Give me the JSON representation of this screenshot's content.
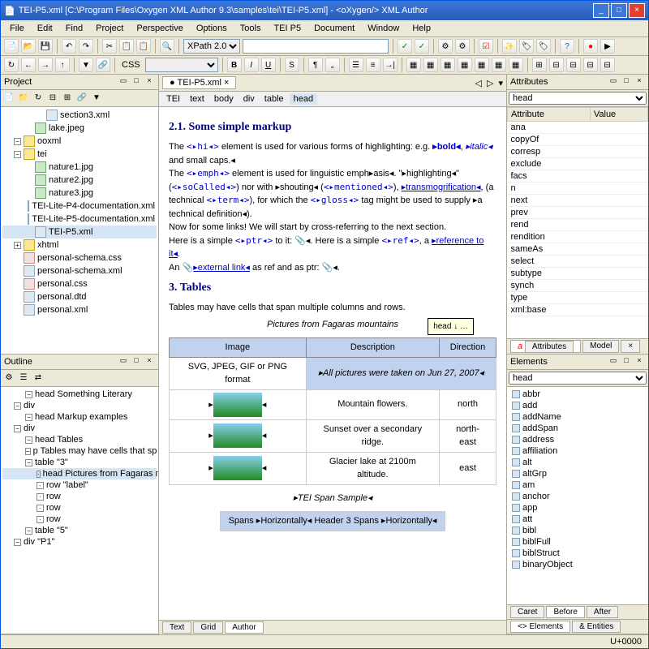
{
  "window": {
    "title": "TEI-P5.xml [C:\\Program Files\\Oxygen XML Author 9.3\\samples\\tei\\TEI-P5.xml] - <oXygen/> XML Author"
  },
  "menu": [
    "File",
    "Edit",
    "Find",
    "Project",
    "Perspective",
    "Options",
    "Tools",
    "TEI P5",
    "Document",
    "Window",
    "Help"
  ],
  "toolbar1": {
    "xpath_label": "XPath 2.0"
  },
  "toolbar2": {
    "css_label": "CSS",
    "b": "B",
    "i": "I",
    "u": "U",
    "s": "S"
  },
  "project": {
    "title": "Project",
    "tree": [
      {
        "d": 3,
        "t": "xml",
        "name": "section3.xml"
      },
      {
        "d": 2,
        "t": "img",
        "name": "lake.jpeg"
      },
      {
        "d": 1,
        "t": "folder",
        "name": "ooxml",
        "exp": "−"
      },
      {
        "d": 1,
        "t": "folder",
        "name": "tei",
        "exp": "−"
      },
      {
        "d": 2,
        "t": "img",
        "name": "nature1.jpg"
      },
      {
        "d": 2,
        "t": "img",
        "name": "nature2.jpg"
      },
      {
        "d": 2,
        "t": "img",
        "name": "nature3.jpg"
      },
      {
        "d": 2,
        "t": "xml",
        "name": "TEI-Lite-P4-documentation.xml"
      },
      {
        "d": 2,
        "t": "xml",
        "name": "TEI-Lite-P5-documentation.xml"
      },
      {
        "d": 2,
        "t": "xml",
        "name": "TEI-P5.xml",
        "sel": true
      },
      {
        "d": 1,
        "t": "folder",
        "name": "xhtml",
        "exp": "+"
      },
      {
        "d": 1,
        "t": "css",
        "name": "personal-schema.css"
      },
      {
        "d": 1,
        "t": "xml",
        "name": "personal-schema.xml"
      },
      {
        "d": 1,
        "t": "css",
        "name": "personal.css"
      },
      {
        "d": 1,
        "t": "xml",
        "name": "personal.dtd"
      },
      {
        "d": 1,
        "t": "xml",
        "name": "personal.xml"
      }
    ]
  },
  "outline": {
    "title": "Outline",
    "items": [
      {
        "d": 1,
        "name": "head Something Literary"
      },
      {
        "d": 0,
        "name": "div"
      },
      {
        "d": 1,
        "name": "head Markup examples"
      },
      {
        "d": 0,
        "name": "div"
      },
      {
        "d": 1,
        "name": "head Tables"
      },
      {
        "d": 1,
        "name": "p Tables may have cells that sp"
      },
      {
        "d": 1,
        "name": "table \"3\""
      },
      {
        "d": 2,
        "name": "head Pictures from Fagaras mountai",
        "sel": true
      },
      {
        "d": 2,
        "name": "row \"label\""
      },
      {
        "d": 2,
        "name": "row"
      },
      {
        "d": 2,
        "name": "row"
      },
      {
        "d": 2,
        "name": "row"
      },
      {
        "d": 1,
        "name": "table \"5\""
      },
      {
        "d": 0,
        "name": "div \"P1\""
      }
    ]
  },
  "doc": {
    "tab": "TEI-P5.xml",
    "crumbs": [
      "TEI",
      "text",
      "body",
      "div",
      "table",
      "head"
    ],
    "h1": "2.1. Some simple markup",
    "p1a": "The ",
    "p1_tag": "<▸hi◂>",
    "p1b": " element is used for various forms of highlighting: e.g. ",
    "p1_bold": "▸bold◂",
    "p1c": ", ",
    "p1_italic": "▸italic◂",
    "p1d": " and small caps.◂",
    "p2a": "The ",
    "p2_emph": "<▸emph◂>",
    "p2b": " element is used for linguistic emph▸asis◂. \"▸highlighting◂\" (",
    "p2_so": "<▸soCalled◂>",
    "p2c": ") nor with ▸shouting◂ (",
    "p2_men": "<▸mentioned◂>",
    "p2d": "), ",
    "p2_trans": "▸transmogrification◂",
    "p2e": ", (a technical ",
    "p2_term": "<▸term◂>",
    "p2f": "), for which the ",
    "p2_gloss": "<▸gloss◂>",
    "p2g": " tag might be used to supply ▸a technical definition◂).",
    "p3": "Now for some links! We will start by cross-referring to the next section.",
    "p4a": "Here is a simple ",
    "p4_ptr": "<▸ptr◂>",
    "p4b": " to it: 📎◂. Here is a simple ",
    "p4_ref": "<▸ref◂>",
    "p4c": ", a ",
    "p4_reflink": "▸reference to it◂",
    "p4d": ".",
    "p5a": "An 📎",
    "p5_link": "▸external link◂",
    "p5b": " as ref and as ptr: 📎◂.",
    "h2": "3. Tables",
    "p6": "Tables may have cells that span multiple columns and rows.",
    "caption": "Pictures from Fagaras mountains",
    "th1": "Image",
    "th2": "Description",
    "th3": "Direction",
    "tooltip": "head ↓ …",
    "chart_data": {
      "type": "table",
      "title": "Pictures from Fagaras mountains",
      "columns": [
        "Image",
        "Description",
        "Direction"
      ],
      "rows": [
        [
          "SVG, JPEG, GIF or PNG format",
          "▸All pictures were taken on Jun 27, 2007◂",
          ""
        ],
        [
          "",
          "Mountain flowers.",
          "north"
        ],
        [
          "",
          "Sunset over a secondary ridge.",
          "north-east"
        ],
        [
          "",
          "Glacier lake at 2100m altitude.",
          "east"
        ]
      ]
    },
    "span_caption": "▸TEI Span Sample◂",
    "span_row": "Spans ▸Horizontally◂ Header 3 Spans ▸Horizontally◂",
    "bottom_tabs": [
      "Text",
      "Grid",
      "Author"
    ]
  },
  "attributes": {
    "title": "Attributes",
    "element": "head",
    "cols": [
      "Attribute",
      "Value"
    ],
    "rows": [
      "ana",
      "copyOf",
      "corresp",
      "exclude",
      "facs",
      "n",
      "next",
      "prev",
      "rend",
      "rendition",
      "sameAs",
      "select",
      "subtype",
      "synch",
      "type",
      "xml:base"
    ],
    "tab1": "Attributes",
    "tab2": "Model"
  },
  "elements": {
    "title": "Elements",
    "element": "head",
    "list": [
      "abbr",
      "add",
      "addName",
      "addSpan",
      "address",
      "affiliation",
      "alt",
      "altGrp",
      "am",
      "anchor",
      "app",
      "att",
      "bibl",
      "biblFull",
      "biblStruct",
      "binaryObject"
    ],
    "tabs": [
      "Caret",
      "Before",
      "After"
    ],
    "btabs": [
      "Elements",
      "Entities"
    ]
  },
  "status": "U+0000"
}
